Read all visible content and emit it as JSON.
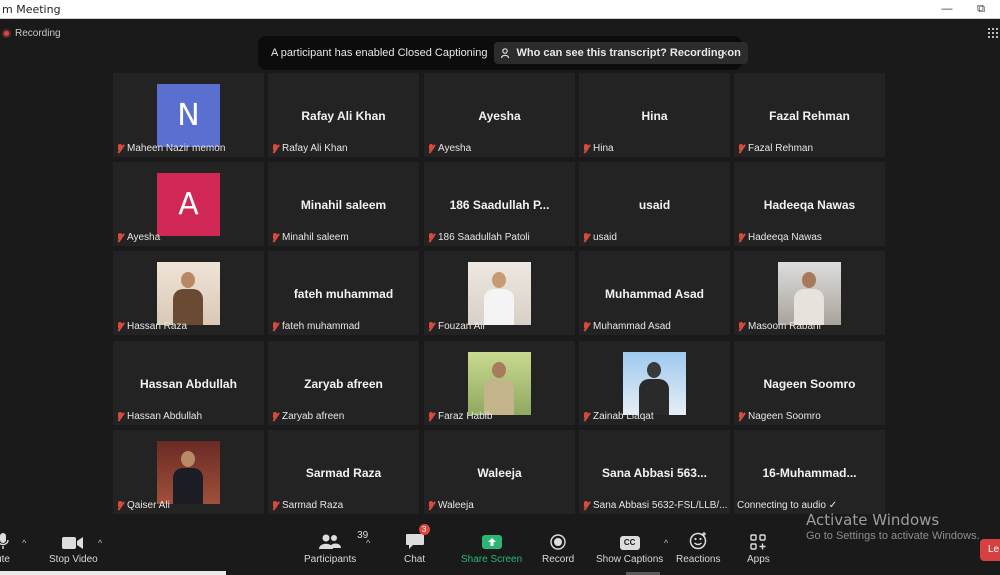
{
  "window": {
    "title": "m Meeting",
    "minimize": "—",
    "maximize": "⧉"
  },
  "recording": {
    "label": "Recording"
  },
  "banner": {
    "message": "A participant has enabled Closed Captioning",
    "link": "Who can see this transcript? Recording on",
    "close": "×"
  },
  "tiles": [
    {
      "label": "Maheen Nazir memon",
      "avatar": "N",
      "avatar_color": "#5a6fd0"
    },
    {
      "name": "Rafay Ali Khan",
      "label": "Rafay Ali Khan"
    },
    {
      "name": "Ayesha",
      "label": "Ayesha"
    },
    {
      "name": "Hina",
      "label": "Hina"
    },
    {
      "name": "Fazal Rehman",
      "label": "Fazal Rehman"
    },
    {
      "label": "Ayesha",
      "avatar": "A",
      "avatar_color": "#d12754"
    },
    {
      "name": "Minahil saleem",
      "label": "Minahil saleem"
    },
    {
      "name": "186 Saadullah P...",
      "label": "186 Saadullah Patoli"
    },
    {
      "name": "usaid",
      "label": "usaid"
    },
    {
      "name": "Hadeeqa Nawas",
      "label": "Hadeeqa Nawas"
    },
    {
      "label": "Hassan Raza",
      "photo": "photo-man-brown-jacket"
    },
    {
      "name": "fateh muhammad",
      "label": "fateh muhammad"
    },
    {
      "label": "Fouzan Ali",
      "photo": "photo-young-man-white-shirt"
    },
    {
      "name": "Muhammad Asad",
      "label": "Muhammad Asad"
    },
    {
      "label": "Masoom Rabani",
      "photo": "photo-young-man-cap"
    },
    {
      "name": "Hassan Abdullah",
      "label": "Hassan Abdullah"
    },
    {
      "name": "Zaryab afreen",
      "label": "Zaryab afreen"
    },
    {
      "label": "Faraz Habib",
      "photo": "photo-man-outdoors"
    },
    {
      "label": "Zainab Liaqat",
      "photo": "photo-woman-blue-sky"
    },
    {
      "name": "Nageen Soomro",
      "label": "Nageen Soomro"
    },
    {
      "label": "Qaiser Ali",
      "photo": "photo-man-suit"
    },
    {
      "name": "Sarmad Raza",
      "label": "Sarmad Raza"
    },
    {
      "name": "Waleeja",
      "label": "Waleeja"
    },
    {
      "name": "Sana Abbasi 563...",
      "label": "Sana Abbasi 5632-FSL/LLB/..."
    },
    {
      "name": "16-Muhammad...",
      "label": "Connecting to audio ✓",
      "no_mic": true
    }
  ],
  "toolbar": {
    "mute": "ute",
    "stop_video": "Stop Video",
    "participants": "Participants",
    "participant_count": "39",
    "chat": "Chat",
    "chat_badge": "3",
    "share_screen": "Share Screen",
    "record": "Record",
    "show_captions": "Show Captions",
    "captions_icon": "CC",
    "reactions": "Reactions",
    "apps": "Apps",
    "caret": "^",
    "leave": "Le"
  },
  "watermark": {
    "title": "Activate Windows",
    "subtitle": "Go to Settings to activate Windows."
  },
  "colors": {
    "share_green": "#2bb673",
    "leave_red": "#d64040",
    "background": "#1a1a1a",
    "tile": "#232323"
  }
}
